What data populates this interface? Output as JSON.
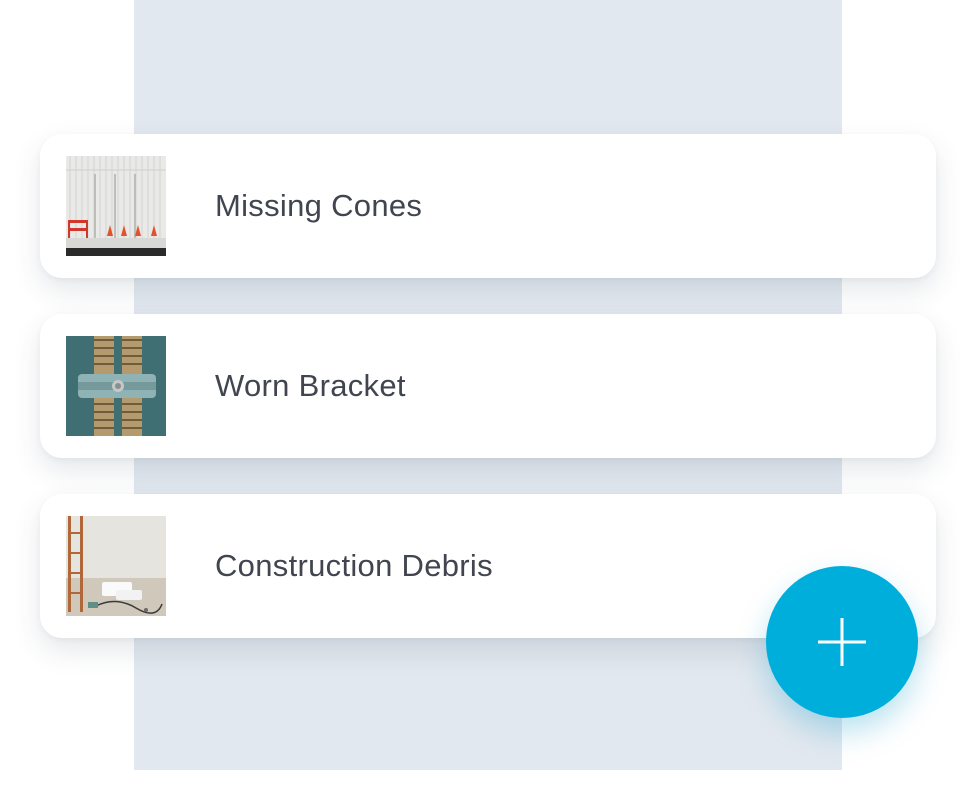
{
  "items": [
    {
      "label": "Missing Cones",
      "thumbnail_icon": "traffic-cones-photo"
    },
    {
      "label": "Worn Bracket",
      "thumbnail_icon": "bracket-photo"
    },
    {
      "label": "Construction Debris",
      "thumbnail_icon": "construction-debris-photo"
    }
  ],
  "fab": {
    "icon": "plus-icon",
    "color": "#00aedc"
  },
  "colors": {
    "backdrop": "#e2e8ef",
    "card": "#ffffff",
    "text": "#40454f"
  }
}
